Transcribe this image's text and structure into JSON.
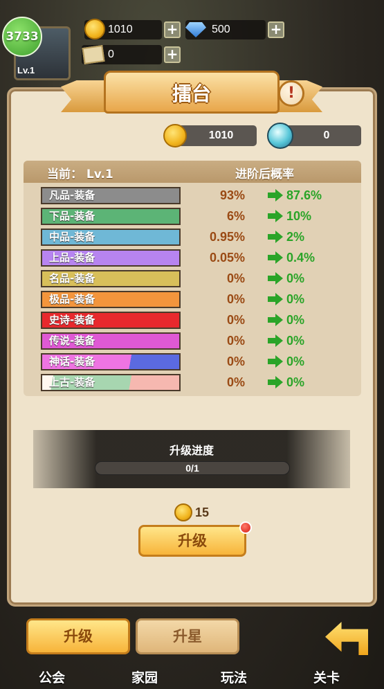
{
  "top_bar": {
    "badge_value": "3733",
    "player_level": "Lv.1",
    "gold": "1010",
    "diamonds": "500",
    "tickets": "0"
  },
  "panel": {
    "title": "擂台",
    "gold": "1010",
    "crystal": "0",
    "table": {
      "header_current": "当前：  Lv.1",
      "header_after": "进阶后概率",
      "rows": [
        {
          "label": "凡品-装备",
          "current": "93%",
          "after": "87.6%",
          "color": "#8c8c8c"
        },
        {
          "label": "下品-装备",
          "current": "6%",
          "after": "10%",
          "color": "#5cb476"
        },
        {
          "label": "中品-装备",
          "current": "0.95%",
          "after": "2%",
          "color": "#6fb8d6"
        },
        {
          "label": "上品-装备",
          "current": "0.05%",
          "after": "0.4%",
          "color": "#b784f0"
        },
        {
          "label": "名品-装备",
          "current": "0%",
          "after": "0%",
          "color": "#d8bf5a"
        },
        {
          "label": "极品-装备",
          "current": "0%",
          "after": "0%",
          "color": "#f3953c"
        },
        {
          "label": "史诗-装备",
          "current": "0%",
          "after": "0%",
          "color": "#e8292d"
        },
        {
          "label": "传说-装备",
          "current": "0%",
          "after": "0%",
          "color": "#df59d4"
        },
        {
          "label": "神话-装备",
          "current": "0%",
          "after": "0%",
          "color": "#ee74e2"
        },
        {
          "label": "上古-装备",
          "current": "0%",
          "after": "0%",
          "color": "#a7d6b0"
        }
      ]
    },
    "progress": {
      "label": "升级进度",
      "value": "0/1",
      "fraction": 0
    },
    "cost": "15",
    "upgrade_button": "升级"
  },
  "tabs": {
    "upgrade": "升级",
    "star": "升星"
  },
  "nav": [
    "公会",
    "家园",
    "玩法",
    "关卡"
  ]
}
